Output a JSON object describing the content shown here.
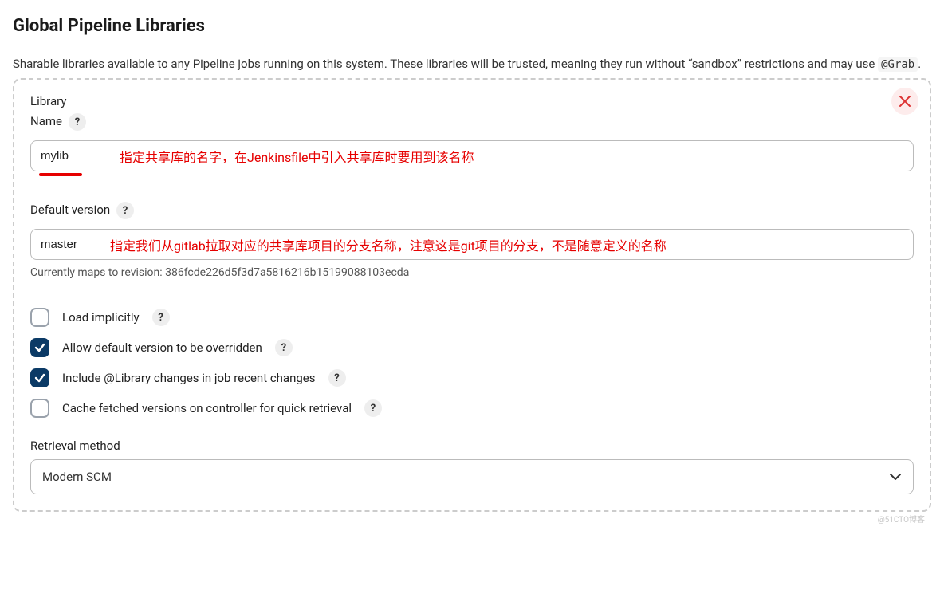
{
  "title": "Global Pipeline Libraries",
  "description_pre": "Sharable libraries available to any Pipeline jobs running on this system. These libraries will be trusted, meaning they run without “sandbox” restrictions and may use ",
  "description_code": "@Grab",
  "description_post": ".",
  "library": {
    "header": "Library",
    "name_label": "Name",
    "name_value": "mylib",
    "name_annotation": "指定共享库的名字，在Jenkinsfile中引入共享库时要用到该名称",
    "default_version_label": "Default version",
    "default_version_value": "master",
    "default_version_annotation": "指定我们从gitlab拉取对应的共享库项目的分支名称，注意这是git项目的分支，不是随意定义的名称",
    "revision_hint": "Currently maps to revision: 386fcde226d5f3d7a5816216b15199088103ecda",
    "checkboxes": [
      {
        "label": "Load implicitly",
        "checked": false
      },
      {
        "label": "Allow default version to be overridden",
        "checked": true
      },
      {
        "label": "Include @Library changes in job recent changes",
        "checked": true
      },
      {
        "label": "Cache fetched versions on controller for quick retrieval",
        "checked": false
      }
    ],
    "retrieval_label": "Retrieval method",
    "retrieval_value": "Modern SCM"
  },
  "help_glyph": "?",
  "watermark": "@51CTO博客"
}
